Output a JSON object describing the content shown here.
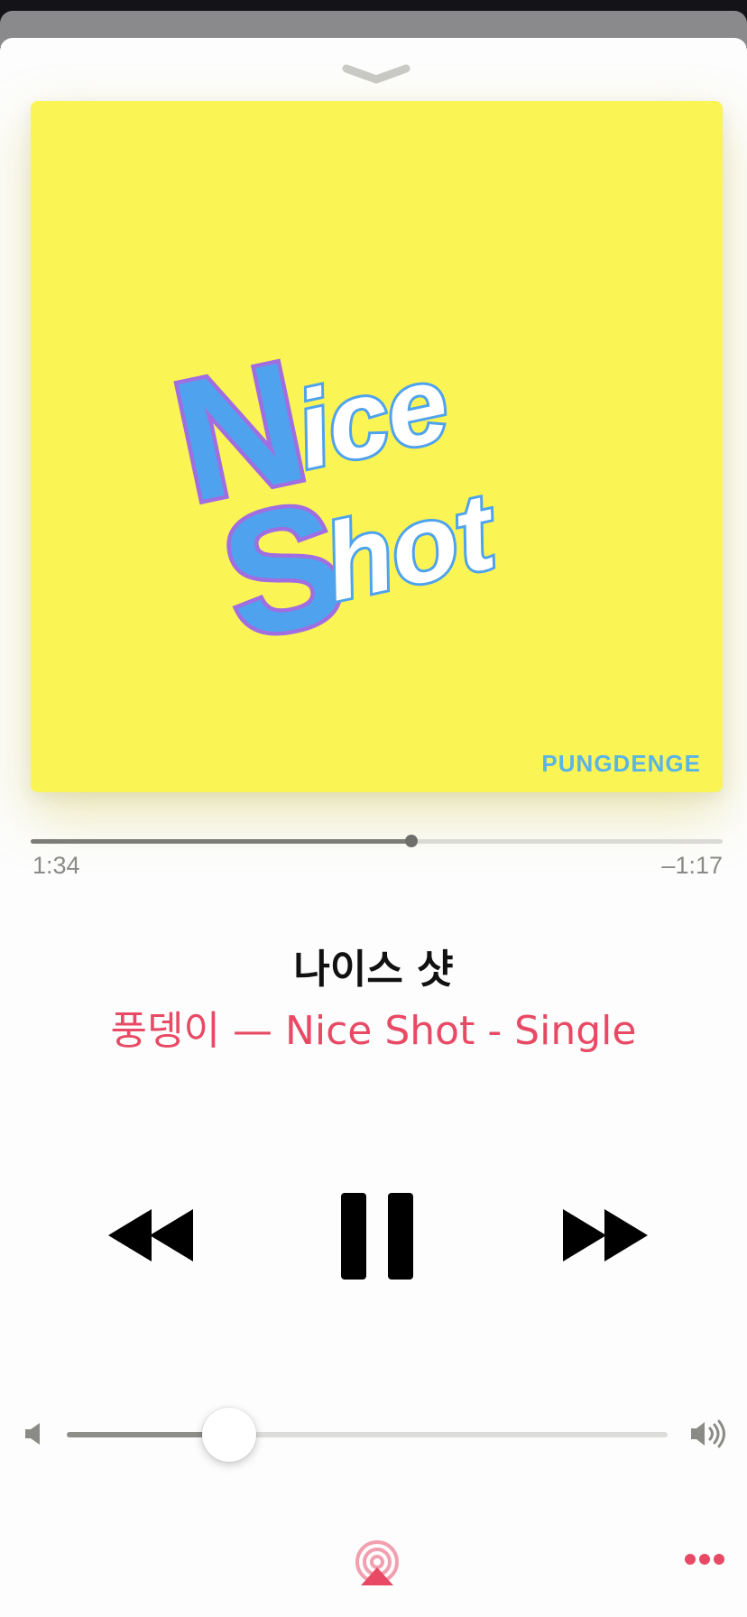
{
  "player": {
    "artwork": {
      "logo_line1": "Nice",
      "logo_line2": "Shot",
      "artist_mark": "PUNGDENGE",
      "background_color": "#fbf455"
    },
    "progress": {
      "elapsed": "1:34",
      "remaining": "–1:17",
      "fraction": 0.55
    },
    "track": {
      "title": "나이스 샷",
      "subtitle": "풍뎅이 — Nice Shot - Single"
    },
    "controls": {
      "rewind_icon": "rewind-icon",
      "pause_icon": "pause-icon",
      "forward_icon": "fast-forward-icon"
    },
    "volume": {
      "level": 0.27,
      "min_icon": "speaker-low-icon",
      "max_icon": "speaker-high-icon"
    },
    "bottom_bar": {
      "airplay_icon": "airplay-icon",
      "more_icon": "more-icon"
    },
    "colors": {
      "accent": "#e84a65",
      "text_primary": "#111111",
      "text_secondary": "#8a8a86"
    }
  }
}
